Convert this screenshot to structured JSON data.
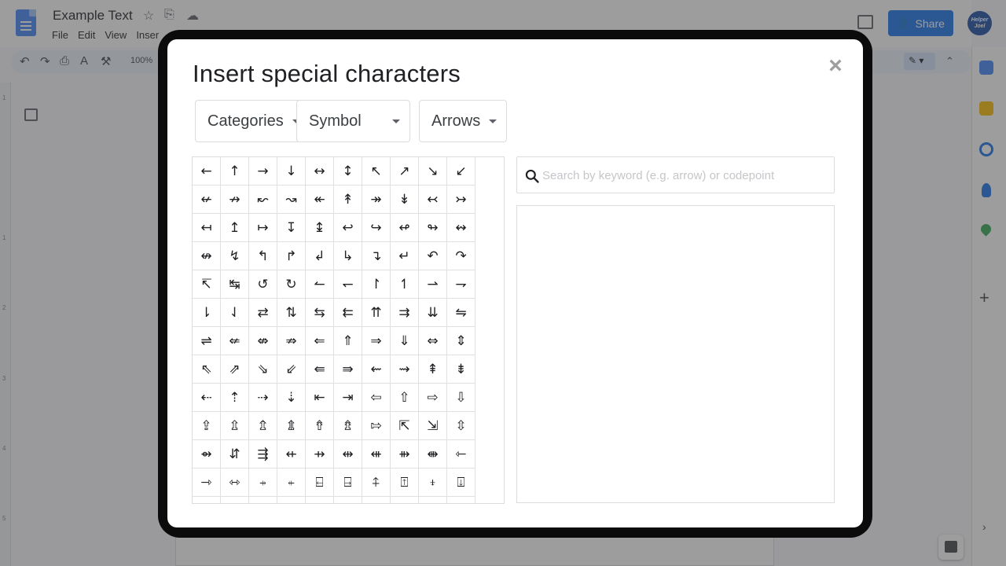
{
  "docs": {
    "document_title": "Example Text",
    "menu": [
      "File",
      "Edit",
      "View",
      "Inser"
    ],
    "share_label": "Share",
    "avatar_text": "Helper Joel",
    "zoom": "100%",
    "ruler_numbers": [
      "1",
      "1",
      "2",
      "3",
      "4",
      "5"
    ]
  },
  "dialog": {
    "title": "Insert special characters",
    "close_glyph": "×",
    "dropdowns": {
      "categories": "Categories",
      "symbol": "Symbol",
      "arrows": "Arrows"
    },
    "search": {
      "placeholder": "Search by keyword (e.g. arrow) or codepoint",
      "value": ""
    },
    "characters": [
      [
        "←",
        "↑",
        "→",
        "↓",
        "↔",
        "↕",
        "↖",
        "↗",
        "↘",
        "↙"
      ],
      [
        "↚",
        "↛",
        "↜",
        "↝",
        "↞",
        "↟",
        "↠",
        "↡",
        "↢",
        "↣"
      ],
      [
        "↤",
        "↥",
        "↦",
        "↧",
        "↨",
        "↩",
        "↪",
        "↫",
        "↬",
        "↭"
      ],
      [
        "↮",
        "↯",
        "↰",
        "↱",
        "↲",
        "↳",
        "↴",
        "↵",
        "↶",
        "↷"
      ],
      [
        "↸",
        "↹",
        "↺",
        "↻",
        "↼",
        "↽",
        "↾",
        "↿",
        "⇀",
        "⇁"
      ],
      [
        "⇂",
        "⇃",
        "⇄",
        "⇅",
        "⇆",
        "⇇",
        "⇈",
        "⇉",
        "⇊",
        "⇋"
      ],
      [
        "⇌",
        "⇍",
        "⇎",
        "⇏",
        "⇐",
        "⇑",
        "⇒",
        "⇓",
        "⇔",
        "⇕"
      ],
      [
        "⇖",
        "⇗",
        "⇘",
        "⇙",
        "⇚",
        "⇛",
        "⇜",
        "⇝",
        "⇞",
        "⇟"
      ],
      [
        "⇠",
        "⇡",
        "⇢",
        "⇣",
        "⇤",
        "⇥",
        "⇦",
        "⇧",
        "⇨",
        "⇩"
      ],
      [
        "⇪",
        "⇫",
        "⇬",
        "⇭",
        "⇮",
        "⇯",
        "⇰",
        "⇱",
        "⇲",
        "⇳"
      ],
      [
        "⇴",
        "⇵",
        "⇶",
        "⇷",
        "⇸",
        "⇹",
        "⇺",
        "⇻",
        "⇼",
        "⇽"
      ],
      [
        "⇾",
        "⇿",
        "⍆",
        "⍅",
        "⍇",
        "⍈",
        "⍏",
        "⍐",
        "⍖",
        "⍗"
      ],
      [
        "",
        "",
        "",
        "",
        "",
        "",
        "",
        "",
        "",
        ""
      ]
    ]
  },
  "colors": {
    "share_button": "#1a73e8",
    "dialog_frame": "#0b0b0b",
    "grid_border": "#e0e0e0"
  }
}
